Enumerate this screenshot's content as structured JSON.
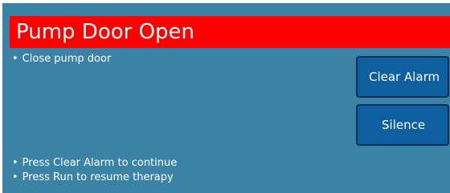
{
  "alarm": {
    "title": "Pump Door Open",
    "banner_color": "#ff0000"
  },
  "messages": {
    "bullet": "•",
    "primary": "Close pump door",
    "instructions": [
      "Press Clear Alarm to continue",
      "Press Run to resume therapy"
    ]
  },
  "buttons": {
    "clear_alarm": "Clear Alarm",
    "silence": "Silence"
  },
  "colors": {
    "background": "#3a82a6",
    "button": "#0d5fa0",
    "text": "#ffffff"
  }
}
